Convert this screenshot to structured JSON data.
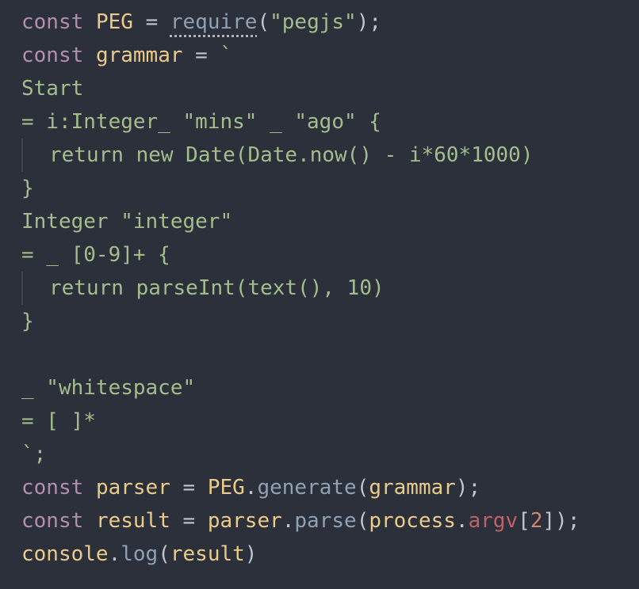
{
  "code": {
    "l1": [
      "const",
      "PEG",
      "=",
      "require",
      "(",
      "\"pegjs\"",
      ");"
    ],
    "l2": [
      "const",
      "grammar",
      "=",
      "`"
    ],
    "l3": "Start",
    "l4": "= i:Integer_ \"mins\" _ \"ago\" {",
    "l5": "return new Date(Date.now() - i*60*1000)",
    "l6": "}",
    "l7": "Integer \"integer\"",
    "l8": "= _ [0-9]+ {",
    "l9": "return parseInt(text(), 10)",
    "l10": "}",
    "l11": "",
    "l12": "_ \"whitespace\"",
    "l13": "= [ ]*",
    "l14": "`;",
    "l15": [
      "const",
      "parser",
      "=",
      "PEG",
      ".",
      "generate",
      "(",
      "grammar",
      ");"
    ],
    "l16": [
      "const",
      "result",
      "=",
      "parser",
      ".",
      "parse",
      "(",
      "process",
      ".",
      "argv",
      "[",
      "2",
      "]);"
    ],
    "l17": [
      "console",
      ".",
      "log",
      "(",
      "result",
      ")"
    ]
  },
  "colors": {
    "background": "#2b303b",
    "keyword": "#b48ead",
    "variable": "#ebcb8b",
    "function": "#8fa1b3",
    "string": "#a3be8c",
    "plain": "#c0c5ce",
    "number": "#d08770",
    "property": "#bf616a"
  }
}
